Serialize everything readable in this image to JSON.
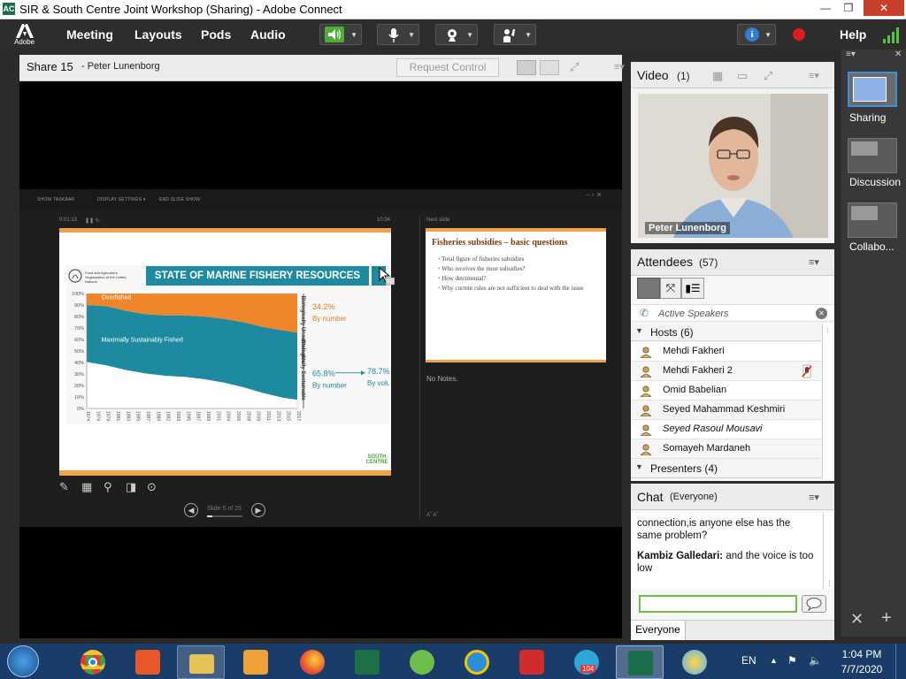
{
  "window": {
    "title": "SIR & South Centre Joint Workshop (Sharing) - Adobe Connect",
    "minimize": "—",
    "maximize": "❐",
    "close": "✕"
  },
  "menubar": {
    "brand": "Adobe",
    "items": [
      "Meeting",
      "Layouts",
      "Pods",
      "Audio"
    ],
    "help": "Help"
  },
  "share_pod": {
    "title": "Share 15",
    "presenter": "- Peter  Lunenborg",
    "request_control": "Request Control",
    "ppt_toolbar": [
      "SHOW TASKBAR",
      "DISPLAY SETTINGS ▾",
      "END SLIDE SHOW"
    ],
    "timer": "0:01:13",
    "clock": "10:34",
    "next_slide_label": "Next slide",
    "slide_counter": "Slide 5 of 29",
    "notes": "No Notes.",
    "font_controls": "Aˆ  Aˇ"
  },
  "current_slide": {
    "title": "STATE OF MARINE FISHERY RESOURCES",
    "logo_text": "Food and Agriculture Organization of the United Nations",
    "footer_logo": "SOUTH CENTRE"
  },
  "chart_data": {
    "type": "area",
    "title": "STATE OF MARINE FISHERY RESOURCES",
    "x": [
      1974,
      1978,
      1982,
      1986,
      1990,
      1994,
      1998,
      2002,
      2006,
      2010,
      2014,
      2017
    ],
    "x_ticks": [
      "1974",
      "1976",
      "1979",
      "1981",
      "1983",
      "1985",
      "1987",
      "1989",
      "1992",
      "1993",
      "1995",
      "1997",
      "1999",
      "2001",
      "2004",
      "2006",
      "2008",
      "2009",
      "2011",
      "2013",
      "2015",
      "2017"
    ],
    "y_ticks": [
      "0%",
      "10%",
      "20%",
      "30%",
      "40%",
      "50%",
      "60%",
      "70%",
      "80%",
      "90%",
      "100%"
    ],
    "ylim": [
      0,
      100
    ],
    "stacked": true,
    "series": [
      {
        "name": "Underfished",
        "color": "#ffffff",
        "values": [
          40,
          37,
          33,
          30,
          28,
          27,
          25,
          22,
          18,
          13,
          9,
          7
        ]
      },
      {
        "name": "Maximally Sustainably Fished",
        "color": "#1e8aa0",
        "values": [
          50,
          52,
          52,
          52,
          53,
          54,
          55,
          56,
          57,
          58,
          59,
          59
        ]
      },
      {
        "name": "Overfished",
        "color": "#f0862c",
        "values": [
          10,
          11,
          15,
          18,
          19,
          19,
          20,
          22,
          25,
          29,
          32,
          34
        ]
      }
    ],
    "annotations": {
      "unsustainable_label": "Biologically Unsustainable",
      "sustainable_label": "Biologically Sustainable",
      "overfished_pct": "34.2%",
      "by_number_1": "By number",
      "sustainable_pct": "65.8%",
      "by_number_2": "By number",
      "arrow_pct": "78.7%",
      "by_volume": "By volume"
    }
  },
  "next_slide": {
    "title": "Fisheries subsidies – basic questions",
    "bullets": [
      "Total figure of fisheries subsidies",
      "Who receives the most subsidies?",
      "How detrimental?",
      "Why current rules are not sufficient to deal with the issue"
    ]
  },
  "video_pod": {
    "title": "Video",
    "count": "(1)",
    "name": "Peter  Lunenborg"
  },
  "attendees_pod": {
    "title": "Attendees",
    "count": "(57)",
    "active_speakers": "Active Speakers",
    "hosts_header": "Hosts (6)",
    "hosts": [
      "Mehdi Fakheri",
      "Mehdi Fakheri 2",
      "Omid Babelian",
      "Seyed Mahammad Keshmiri",
      "Seyed Rasoul Mousavi",
      "Somayeh Mardaneh"
    ],
    "presenters_header": "Presenters (4)"
  },
  "chat_pod": {
    "title": "Chat",
    "scope": "(Everyone)",
    "msg1": "connection,is anyone else has the same problem?",
    "msg2_author": "Kambiz Galledari:",
    "msg2_text": "and the voice is too low",
    "footer_tab": "Everyone"
  },
  "layouts_panel": {
    "items": [
      "Sharing",
      "Discussion",
      "Collabo..."
    ]
  },
  "taskbar": {
    "badge": "104",
    "lang": "EN",
    "time": "1:04 PM",
    "date": "7/7/2020"
  }
}
